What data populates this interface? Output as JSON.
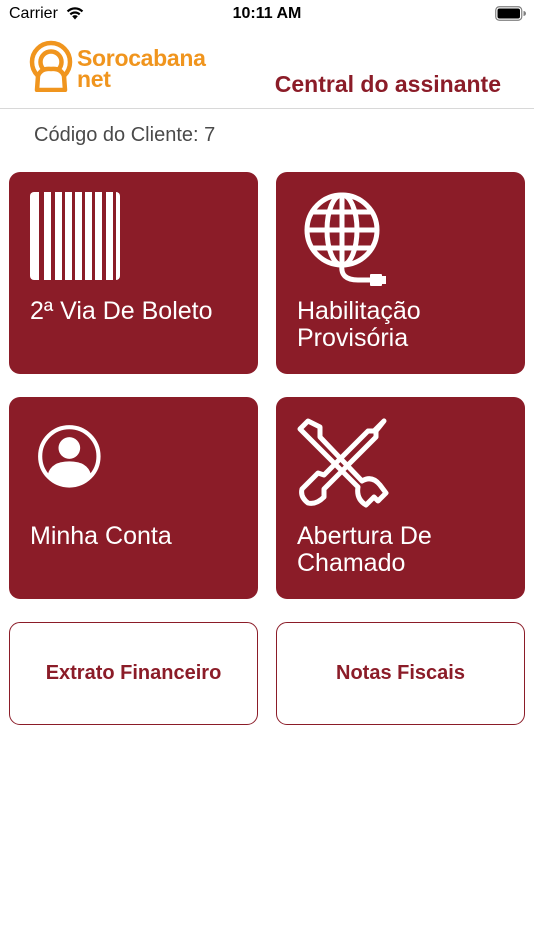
{
  "status_bar": {
    "carrier": "Carrier",
    "time": "10:11 AM"
  },
  "header": {
    "logo_line1": "Sorocabana",
    "logo_line2": "net",
    "title": "Central do assinante"
  },
  "client": {
    "code_label": "Código do Cliente: 7"
  },
  "tiles": [
    {
      "label_line1": "2ª Via De Boleto",
      "label_line2": "",
      "icon": "barcode-icon"
    },
    {
      "label_line1": "Habilitação",
      "label_line2": "Provisória",
      "icon": "globe-cable-icon"
    },
    {
      "label_line1": "Minha Conta",
      "label_line2": "",
      "icon": "user-avatar-icon"
    },
    {
      "label_line1": "Abertura De",
      "label_line2": "Chamado",
      "icon": "tools-icon"
    }
  ],
  "buttons": {
    "statement": "Extrato Financeiro",
    "invoices": "Notas Fiscais"
  },
  "colors": {
    "brand_red": "#8b1c28",
    "logo_orange": "#f0951e"
  }
}
